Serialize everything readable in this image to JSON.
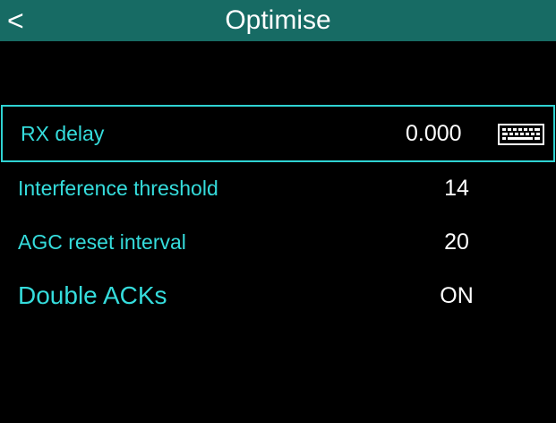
{
  "header": {
    "back_label": "<",
    "title": "Optimise"
  },
  "rows": [
    {
      "label": "RX delay",
      "value": "0.000",
      "icon": "keyboard-icon",
      "selected": true
    },
    {
      "label": "Interference threshold",
      "value": "14"
    },
    {
      "label": "AGC reset interval",
      "value": "20"
    },
    {
      "label": "Double ACKs",
      "value": "ON"
    }
  ],
  "colors": {
    "header_bg": "#176b64",
    "label": "#35dcdc",
    "value": "#ffffff",
    "selection_border": "#2fd3d3",
    "background": "#000000"
  }
}
